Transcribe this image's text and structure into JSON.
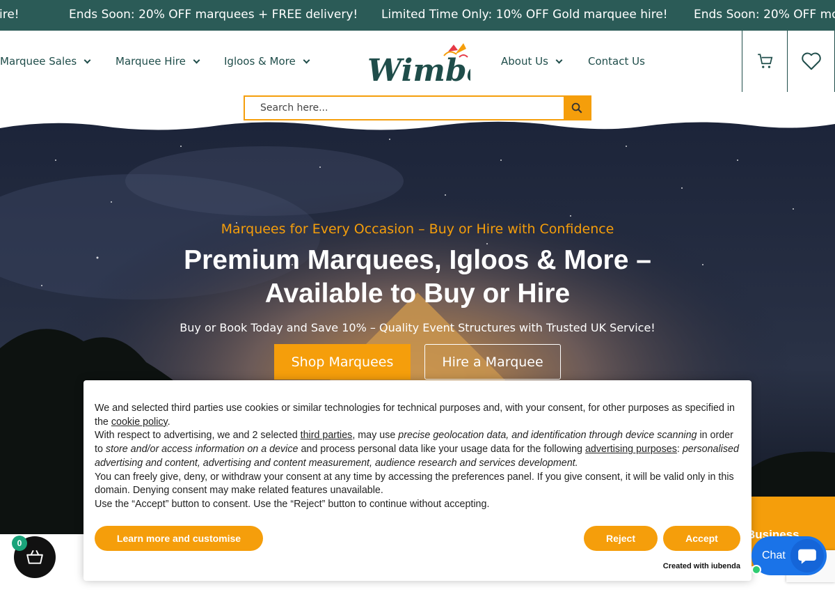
{
  "ticker": {
    "items": [
      "ire!",
      "Ends Soon: 20% OFF marquees + FREE delivery!",
      "Limited Time Only: 10% OFF Gold marquee hire!",
      "Ends Soon: 20% OFF mo"
    ]
  },
  "nav": {
    "left": [
      {
        "label": "Marquee Sales"
      },
      {
        "label": "Marquee Hire"
      },
      {
        "label": "Igloos & More"
      }
    ],
    "right": [
      {
        "label": "About Us"
      },
      {
        "label": "Contact Us"
      }
    ],
    "logo_text": "Wimba"
  },
  "search": {
    "placeholder": "Search here..."
  },
  "hero": {
    "subtitle": "Marquees for Every Occasion – Buy or Hire with Confidence",
    "title": "Premium Marquees, Igloos & More – Available to Buy or Hire",
    "tagline": "Buy or Book Today and Save 10% – Quality Event Structures with Trusted UK Service!",
    "btn_shop": "Shop Marquees",
    "btn_hire": "Hire a Marquee"
  },
  "cookie": {
    "p1_a": "We and selected third parties use cookies or similar technologies for technical purposes and, with your consent, for other purposes as specified in the ",
    "p1_link": "cookie policy",
    "p1_b": ".",
    "p2_a": "With respect to advertising, we and 2 selected ",
    "p2_link1": "third parties",
    "p2_b": ", may use ",
    "p2_i1": "precise geolocation data, and identification through device scanning",
    "p2_c": " in order to ",
    "p2_i2": "store and/or access information on a device",
    "p2_d": " and process personal data like your usage data for the following ",
    "p2_link2": "advertising purposes",
    "p2_e": ": ",
    "p2_i3": "personalised advertising and content, advertising and content measurement, audience research and services development.",
    "p3": "You can freely give, deny, or withdraw your consent at any time by accessing the preferences panel. If you give consent, it will be valid only in this domain. Denying consent may make related features unavailable.",
    "p4": "Use the “Accept” button to consent. Use the “Reject” button to continue without accepting.",
    "btn_learn": "Learn more and customise",
    "btn_reject": "Reject",
    "btn_accept": "Accept",
    "credit": "Created with iubenda"
  },
  "cart": {
    "count": "0"
  },
  "chat": {
    "label": "Chat"
  },
  "side": {
    "business": "Business"
  },
  "colors": {
    "brand_teal": "#1f4d4a",
    "ticker_bg": "#2b5b57",
    "accent_orange": "#f59e0b",
    "chat_blue": "#1a73e8"
  }
}
